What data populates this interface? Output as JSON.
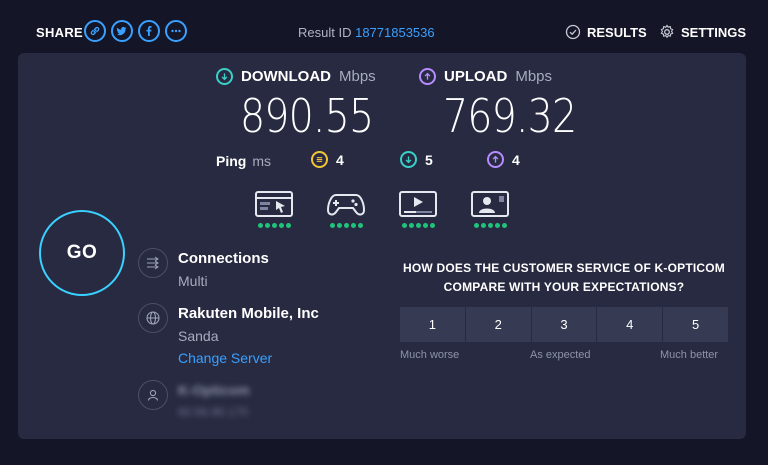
{
  "header": {
    "share_label": "SHARE",
    "share_icons": [
      "link-icon",
      "twitter-icon",
      "facebook-icon",
      "more-icon"
    ],
    "result_id_label": "Result ID",
    "result_id": "18771853536",
    "results_label": "RESULTS",
    "settings_label": "SETTINGS"
  },
  "download": {
    "label": "DOWNLOAD",
    "unit": "Mbps",
    "value": "890.55",
    "color": "#3ad0c8"
  },
  "upload": {
    "label": "UPLOAD",
    "unit": "Mbps",
    "value": "769.32",
    "color": "#b58cff"
  },
  "ping": {
    "label": "Ping",
    "unit": "ms",
    "idle": "4",
    "download": "5",
    "upload": "4",
    "idle_color": "#f3c43a"
  },
  "activities": [
    {
      "name": "browsing",
      "rating": 5
    },
    {
      "name": "gaming",
      "rating": 5
    },
    {
      "name": "streaming",
      "rating": 5
    },
    {
      "name": "video-chat",
      "rating": 5
    }
  ],
  "go_label": "GO",
  "connections": {
    "title": "Connections",
    "value": "Multi"
  },
  "server": {
    "provider": "Rakuten Mobile, Inc",
    "location": "Sanda",
    "change_label": "Change Server"
  },
  "user": {
    "isp": "K-Opticom",
    "ip": "60.56.90.170"
  },
  "survey": {
    "question": "HOW DOES THE CUSTOMER SERVICE OF K-OPTICOM COMPARE WITH YOUR EXPECTATIONS?",
    "options": [
      "1",
      "2",
      "3",
      "4",
      "5"
    ],
    "low_label": "Much worse",
    "mid_label": "As expected",
    "high_label": "Much better"
  }
}
